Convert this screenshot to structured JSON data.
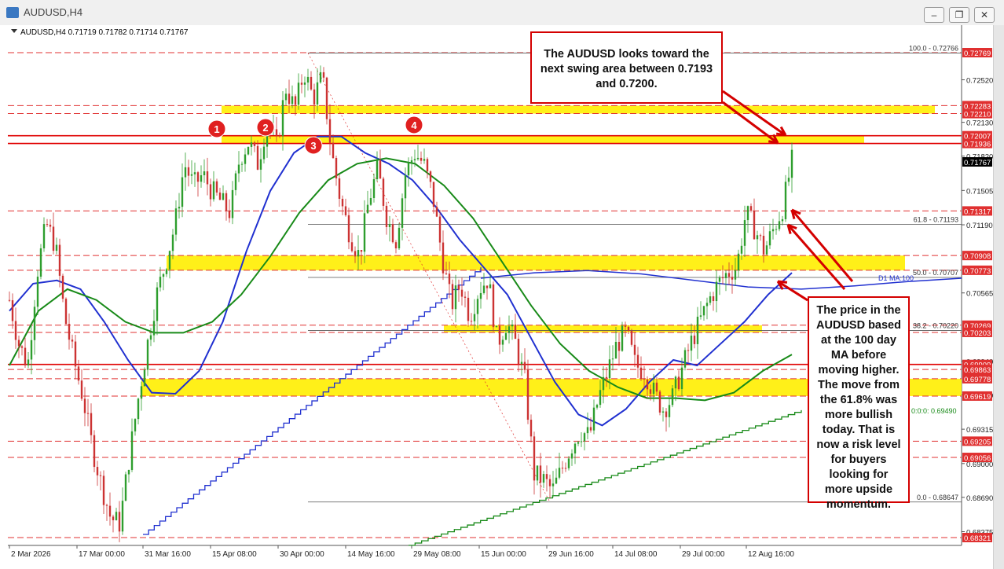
{
  "window": {
    "title": "AUDUSD,H4"
  },
  "chart_data": {
    "type": "line",
    "symbol_info": "AUDUSD,H4  0.71719 0.71782 0.71714 0.71767",
    "price_label": "0.71767",
    "price_axis_ticks": [
      "0.72520",
      "0.72130",
      "0.71820",
      "0.71505",
      "0.71190",
      "0.70565",
      "0.69940",
      "0.69630",
      "0.69315",
      "0.69000",
      "0.68690",
      "0.68375"
    ],
    "date_axis_ticks": [
      "2 Mar 2026",
      "17 Mar 00:00",
      "31 Mar 16:00",
      "15 Apr 08:00",
      "30 Apr 00:00",
      "14 May 16:00",
      "29 May 08:00",
      "15 Jun 00:00",
      "29 Jun 16:00",
      "14 Jul 08:00",
      "29 Jul 00:00",
      "12 Aug 16:00"
    ],
    "horizontal_levels": [
      {
        "label": "0.72769",
        "value": 0.72769,
        "color": "#e03030",
        "style": "dashed"
      },
      {
        "label": "0.72283",
        "value": 0.72283,
        "color": "#e03030",
        "style": "dashed"
      },
      {
        "label": "0.72210",
        "value": 0.7221,
        "color": "#e03030",
        "style": "dashed"
      },
      {
        "label": "0.72007",
        "value": 0.72007,
        "color": "#e00000",
        "style": "solid"
      },
      {
        "label": "0.71936",
        "value": 0.71936,
        "color": "#e00000",
        "style": "solid"
      },
      {
        "label": "0.71317",
        "value": 0.71317,
        "color": "#e03030",
        "style": "dashed"
      },
      {
        "label": "0.70908",
        "value": 0.70908,
        "color": "#e03030",
        "style": "dashed"
      },
      {
        "label": "0.70773",
        "value": 0.70773,
        "color": "#e03030",
        "style": "dashed"
      },
      {
        "label": "0.70269",
        "value": 0.70269,
        "color": "#e03030",
        "style": "dashed"
      },
      {
        "label": "0.70203",
        "value": 0.70203,
        "color": "#e03030",
        "style": "dashed"
      },
      {
        "label": "0.69909",
        "value": 0.69909,
        "color": "#e00000",
        "style": "solid"
      },
      {
        "label": "0.69863",
        "value": 0.69863,
        "color": "#e03030",
        "style": "dashed"
      },
      {
        "label": "0.69778",
        "value": 0.69778,
        "color": "#e03030",
        "style": "dashed"
      },
      {
        "label": "0.69619",
        "value": 0.69619,
        "color": "#e03030",
        "style": "dashed"
      },
      {
        "label": "0.69205",
        "value": 0.69205,
        "color": "#e03030",
        "style": "dashed"
      },
      {
        "label": "0.69056",
        "value": 0.69056,
        "color": "#e03030",
        "style": "dashed"
      },
      {
        "label": "0.68321",
        "value": 0.68321,
        "color": "#e03030",
        "style": "dashed"
      }
    ],
    "fibonacci": [
      {
        "label": "100.0 - 0.72766",
        "value": 0.72766
      },
      {
        "label": "61.8 - 0.71193",
        "value": 0.71193
      },
      {
        "label": "50.0 - 0.70707",
        "value": 0.70707
      },
      {
        "label": "38.2 - 0.70220",
        "value": 0.7022
      },
      {
        "label": "0.0 - 0.68647",
        "value": 0.68647
      }
    ],
    "fan_label": "0:0:0: 0.69490",
    "ma_label": "D1 MA:100",
    "swing_zones": [
      {
        "from": 0.7221,
        "to": 0.72283
      },
      {
        "from": 0.71936,
        "to": 0.72007
      },
      {
        "from": 0.70773,
        "to": 0.70908
      },
      {
        "from": 0.70203,
        "to": 0.70269
      },
      {
        "from": 0.69619,
        "to": 0.69778
      }
    ],
    "markers": [
      "1",
      "2",
      "3",
      "4"
    ],
    "series": [
      {
        "name": "AUDUSD",
        "color": "#cc3333",
        "type": "candles",
        "values": [
          0.705,
          0.701,
          0.699,
          0.7075,
          0.712,
          0.71,
          0.7035,
          0.6995,
          0.696,
          0.6915,
          0.688,
          0.685,
          0.6845,
          0.6905,
          0.696,
          0.701,
          0.7055,
          0.7085,
          0.712,
          0.7175,
          0.7155,
          0.7165,
          0.715,
          0.714,
          0.713,
          0.718,
          0.7195,
          0.7175,
          0.7215,
          0.719,
          0.7245,
          0.7225,
          0.726,
          0.7235,
          0.7255,
          0.7185,
          0.714,
          0.711,
          0.709,
          0.714,
          0.717,
          0.7125,
          0.7105,
          0.7165,
          0.7185,
          0.7175,
          0.7145,
          0.709,
          0.7045,
          0.7065,
          0.7035,
          0.706,
          0.707,
          0.701,
          0.703,
          0.701,
          0.6975,
          0.689,
          0.6885,
          0.6875,
          0.6895,
          0.6915,
          0.693,
          0.6925,
          0.696,
          0.6985,
          0.701,
          0.702,
          0.699,
          0.6985,
          0.6965,
          0.695,
          0.696,
          0.6985,
          0.701,
          0.703,
          0.705,
          0.7065,
          0.7075,
          0.708,
          0.713,
          0.7115,
          0.7095,
          0.7115,
          0.7135,
          0.7177
        ]
      },
      {
        "name": "MA fast",
        "color": "#2030d0",
        "values": [
          0.704,
          0.7065,
          0.7068,
          0.706,
          0.703,
          0.6995,
          0.6965,
          0.6964,
          0.6985,
          0.703,
          0.7095,
          0.715,
          0.7185,
          0.72,
          0.72,
          0.7185,
          0.7175,
          0.716,
          0.7135,
          0.7105,
          0.708,
          0.7055,
          0.7015,
          0.6975,
          0.6945,
          0.6935,
          0.695,
          0.6975,
          0.6995,
          0.699,
          0.701,
          0.703,
          0.7055,
          0.7075
        ]
      },
      {
        "name": "MA slow",
        "color": "#188a18",
        "values": [
          0.699,
          0.704,
          0.706,
          0.705,
          0.703,
          0.702,
          0.702,
          0.703,
          0.7055,
          0.709,
          0.713,
          0.716,
          0.7175,
          0.718,
          0.7175,
          0.7155,
          0.7125,
          0.7085,
          0.7045,
          0.701,
          0.6985,
          0.697,
          0.696,
          0.696,
          0.6958,
          0.6965,
          0.6985,
          0.7
        ]
      },
      {
        "name": "D1 MA:100",
        "color": "#2030d0",
        "values": [
          0.707,
          0.7075,
          0.7077,
          0.7074,
          0.7068,
          0.7062,
          0.706,
          0.7063,
          0.7067,
          0.707
        ]
      }
    ]
  },
  "annotations": {
    "note_top": "The AUDUSD looks toward the next swing area between 0.7193 and 0.7200.",
    "note_right": "The price in the AUDUSD based at the 100 day MA before moving higher. The move from the 61.8% was more bullish today. That is now a risk level for buyers looking for more upside momentum."
  }
}
